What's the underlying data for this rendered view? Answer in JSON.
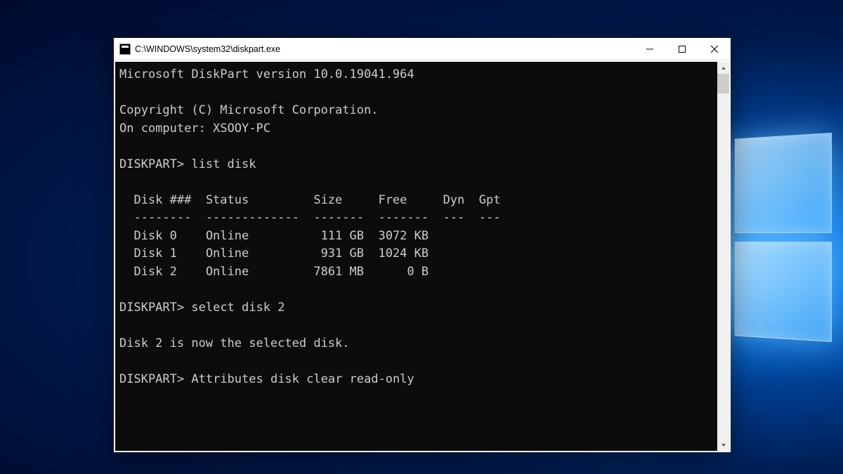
{
  "window": {
    "title": "C:\\WINDOWS\\system32\\diskpart.exe"
  },
  "console": {
    "version_line": "Microsoft DiskPart version 10.0.19041.964",
    "copyright": "Copyright (C) Microsoft Corporation.",
    "computer_line": "On computer: XSOOY-PC",
    "prompt": "DISKPART>",
    "cmd1": "list disk",
    "table": {
      "header": "  Disk ###  Status         Size     Free     Dyn  Gpt",
      "divider": "  --------  -------------  -------  -------  ---  ---",
      "rows": [
        "  Disk 0    Online          111 GB  3072 KB        ",
        "  Disk 1    Online          931 GB  1024 KB        ",
        "  Disk 2    Online         7861 MB      0 B        "
      ]
    },
    "cmd2": "select disk 2",
    "response2": "Disk 2 is now the selected disk.",
    "cmd3": "Attributes disk clear read-only"
  }
}
